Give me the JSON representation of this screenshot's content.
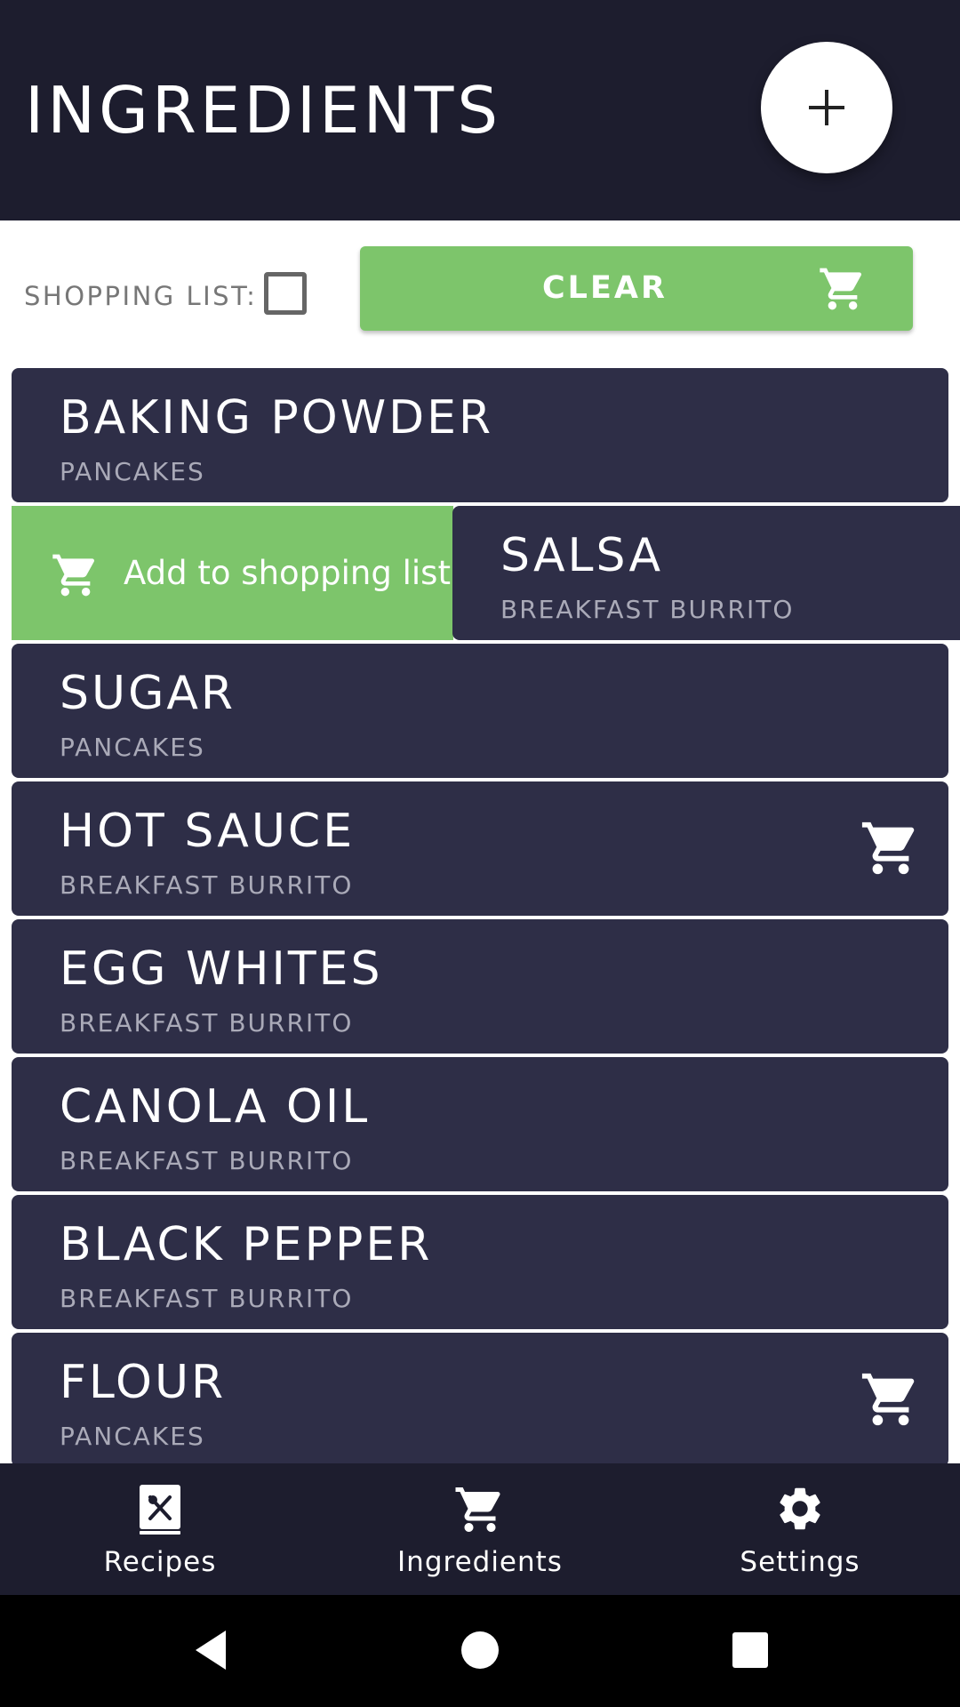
{
  "header": {
    "title": "INGREDIENTS",
    "fab_icon": "plus-icon"
  },
  "toolbar": {
    "shopping_list_label": "SHOPPING LIST:",
    "shopping_list_checked": false,
    "clear_label": "CLEAR",
    "clear_icon": "cart-icon"
  },
  "swipe_action": {
    "label": "Add to shopping list",
    "icon": "cart-icon"
  },
  "ingredients": [
    {
      "name": "BAKING POWDER",
      "recipe": "PANCAKES",
      "in_cart": false
    },
    {
      "name": "SALSA",
      "recipe": "BREAKFAST BURRITO",
      "in_cart": false
    },
    {
      "name": "SUGAR",
      "recipe": "PANCAKES",
      "in_cart": false
    },
    {
      "name": "HOT SAUCE",
      "recipe": "BREAKFAST BURRITO",
      "in_cart": true
    },
    {
      "name": "EGG WHITES",
      "recipe": "BREAKFAST BURRITO",
      "in_cart": false
    },
    {
      "name": "CANOLA OIL",
      "recipe": "BREAKFAST BURRITO",
      "in_cart": false
    },
    {
      "name": "BLACK PEPPER",
      "recipe": "BREAKFAST BURRITO",
      "in_cart": false
    },
    {
      "name": "FLOUR",
      "recipe": "PANCAKES",
      "in_cart": true
    }
  ],
  "bottom_nav": [
    {
      "label": "Recipes",
      "icon": "recipe-book-icon"
    },
    {
      "label": "Ingredients",
      "icon": "cart-icon"
    },
    {
      "label": "Settings",
      "icon": "gear-icon"
    }
  ],
  "colors": {
    "header_bg": "#1d1d2e",
    "card_bg": "#2e2e47",
    "accent_green": "#7dc56b",
    "subtitle_gray": "#aaaab8"
  }
}
